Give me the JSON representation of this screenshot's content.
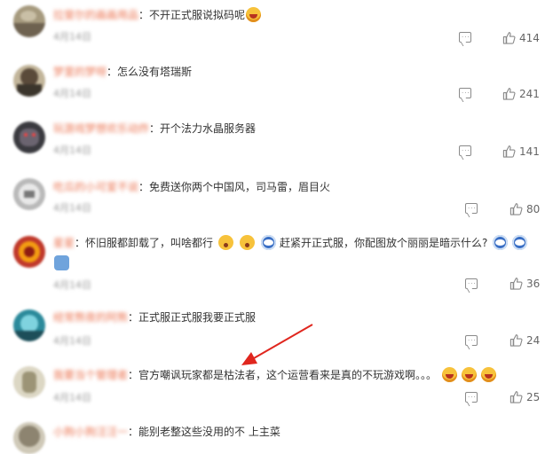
{
  "comments": [
    {
      "username": "拉斐尔的画画用品",
      "text": "不开正式服说拟码呢",
      "meta": "4月14日",
      "likes": "414",
      "emojis": [
        "smile"
      ]
    },
    {
      "username": "梦里的梦呀",
      "text": "怎么没有塔瑞斯",
      "meta": "4月14日",
      "likes": "241",
      "emojis": []
    },
    {
      "username": "玩游戏梦想欢乐动炸",
      "text": "开个法力水晶服务器",
      "meta": "4月14日",
      "likes": "141",
      "emojis": []
    },
    {
      "username": "吃瓜的小可爱不说",
      "text": "免费送你两个中国风，司马雷，眉目火",
      "meta": "4月14日",
      "likes": "80",
      "emojis": []
    },
    {
      "username": "星星",
      "text_a": "怀旧服都卸载了，叫啥都行",
      "text_b": "赶紧开正式服，你配图放个丽丽是暗示什么?",
      "meta": "4月14日",
      "likes": "36",
      "emojis": [
        "shock",
        "shock",
        "doge",
        "doge",
        "flame"
      ]
    },
    {
      "username": "经常熬夜的阿熊",
      "text": "正式服正式服我要正式服",
      "meta": "4月14日",
      "likes": "24",
      "emojis": []
    },
    {
      "username": "我要当个管理者",
      "text": "官方嘲讽玩家都是枯法者，这个运营看来是真的不玩游戏啊。。。",
      "meta": "4月14日",
      "likes": "25",
      "emojis": [
        "smile",
        "smile",
        "smile"
      ]
    },
    {
      "username": "小狗小狗汪汪一",
      "text": "能别老整这些没用的不 上主菜",
      "meta": "",
      "likes": "",
      "emojis": []
    }
  ],
  "colors": {
    "username": "#eb7350",
    "arrow": "#e0261e",
    "icon": "#8a8a8a"
  },
  "icons": {
    "reply": "comment-bubble-icon",
    "like": "thumbs-up-icon"
  }
}
